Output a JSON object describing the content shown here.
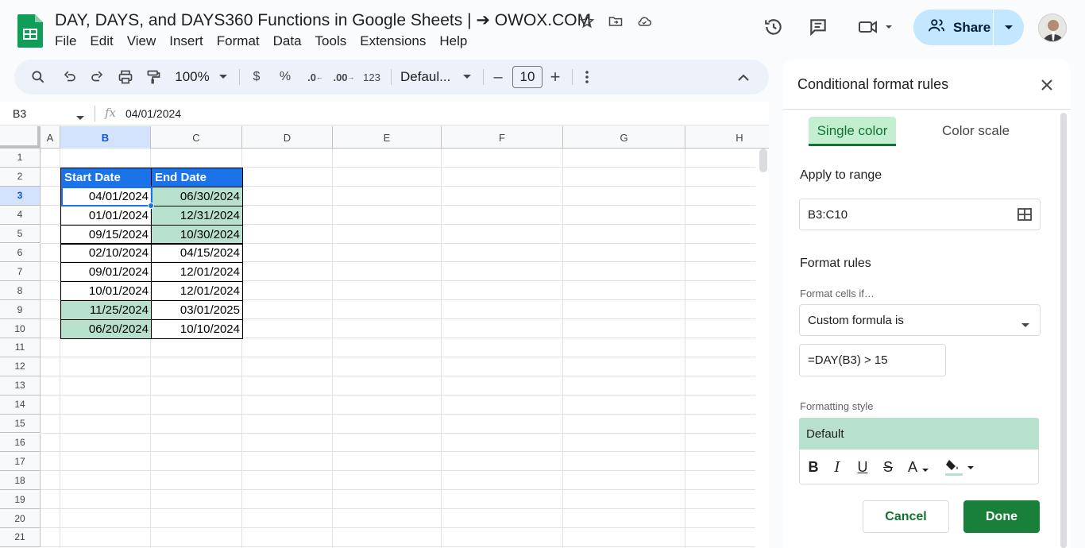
{
  "header": {
    "title": "DAY, DAYS, and DAYS360 Functions in Google Sheets | ➔ OWOX.COM",
    "menu": [
      "File",
      "Edit",
      "View",
      "Insert",
      "Format",
      "Data",
      "Tools",
      "Extensions",
      "Help"
    ],
    "share_label": "Share"
  },
  "toolbar": {
    "zoom": "100%",
    "currency": "$",
    "percent": "%",
    "dec_decrease": ".0",
    "dec_increase": ".00",
    "number_format": "123",
    "font": "Defaul...",
    "font_size": "10",
    "minus": "–",
    "plus": "+"
  },
  "formula_bar": {
    "name_box": "B3",
    "fx": "fx",
    "value": "04/01/2024"
  },
  "grid": {
    "columns": [
      "A",
      "B",
      "C",
      "D",
      "E",
      "F",
      "G",
      "H"
    ],
    "rows": [
      "1",
      "2",
      "3",
      "4",
      "5",
      "6",
      "7",
      "8",
      "9",
      "10",
      "11",
      "12",
      "13",
      "14",
      "15",
      "16",
      "17",
      "18",
      "19",
      "20",
      "21"
    ],
    "headers": [
      "Start Date",
      "End Date"
    ],
    "data": [
      {
        "start": "04/01/2024",
        "end": "06/30/2024"
      },
      {
        "start": "01/01/2024",
        "end": "12/31/2024"
      },
      {
        "start": "09/15/2024",
        "end": "10/30/2024"
      },
      {
        "start": "02/10/2024",
        "end": "04/15/2024"
      },
      {
        "start": "09/01/2024",
        "end": "12/01/2024"
      },
      {
        "start": "10/01/2024",
        "end": "12/01/2024"
      },
      {
        "start": "11/25/2024",
        "end": "03/01/2025"
      },
      {
        "start": "06/20/2024",
        "end": "10/10/2024"
      }
    ],
    "highlight_color": "#b7e1cd",
    "header_color": "#1a73e8"
  },
  "panel": {
    "title": "Conditional format rules",
    "tab_single": "Single color",
    "tab_scale": "Color scale",
    "apply_label": "Apply to range",
    "range": "B3:C10",
    "rules_label": "Format rules",
    "cells_if_label": "Format cells if…",
    "condition": "Custom formula is",
    "formula": "=DAY(B3) > 15",
    "style_label": "Formatting style",
    "style_preview": "Default",
    "style_bold": "B",
    "style_italic": "I",
    "style_underline": "U",
    "style_strike": "S",
    "style_text_color": "A",
    "cancel": "Cancel",
    "done": "Done"
  }
}
